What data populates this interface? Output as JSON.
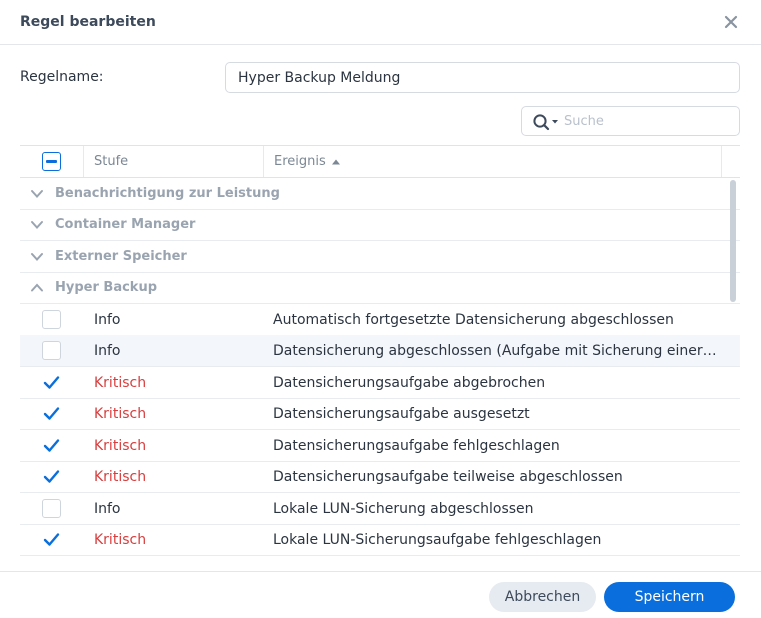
{
  "dialog": {
    "title": "Regel bearbeiten",
    "close_icon": "close-icon"
  },
  "form": {
    "rule_name_label": "Regelname:",
    "rule_name_value": "Hyper Backup Meldung"
  },
  "search": {
    "icon": "search-icon",
    "placeholder": "Suche"
  },
  "table": {
    "columns": {
      "level": "Stufe",
      "event": "Ereignis"
    },
    "sort": "ascending",
    "groups": [
      {
        "label": "Benachrichtigung zur Leistung",
        "expanded": false
      },
      {
        "label": "Container Manager",
        "expanded": false
      },
      {
        "label": "Externer Speicher",
        "expanded": false
      },
      {
        "label": "Hyper Backup",
        "expanded": true
      }
    ],
    "rows": [
      {
        "checked": false,
        "level": "Info",
        "event": "Automatisch fortgesetzte Datensicherung abgeschlossen"
      },
      {
        "checked": false,
        "level": "Info",
        "event": "Datensicherung abgeschlossen (Aufgabe mit Sicherung einer…"
      },
      {
        "checked": true,
        "level": "Kritisch",
        "event": "Datensicherungsaufgabe abgebrochen"
      },
      {
        "checked": true,
        "level": "Kritisch",
        "event": "Datensicherungsaufgabe ausgesetzt"
      },
      {
        "checked": true,
        "level": "Kritisch",
        "event": "Datensicherungsaufgabe fehlgeschlagen"
      },
      {
        "checked": true,
        "level": "Kritisch",
        "event": "Datensicherungsaufgabe teilweise abgeschlossen"
      },
      {
        "checked": false,
        "level": "Info",
        "event": "Lokale LUN-Sicherung abgeschlossen"
      },
      {
        "checked": true,
        "level": "Kritisch",
        "event": "Lokale LUN-Sicherungsaufgabe fehlgeschlagen"
      }
    ]
  },
  "footer": {
    "cancel_label": "Abbrechen",
    "save_label": "Speichern"
  },
  "colors": {
    "accent": "#0a6fdc",
    "critical": "#d93d3d"
  }
}
